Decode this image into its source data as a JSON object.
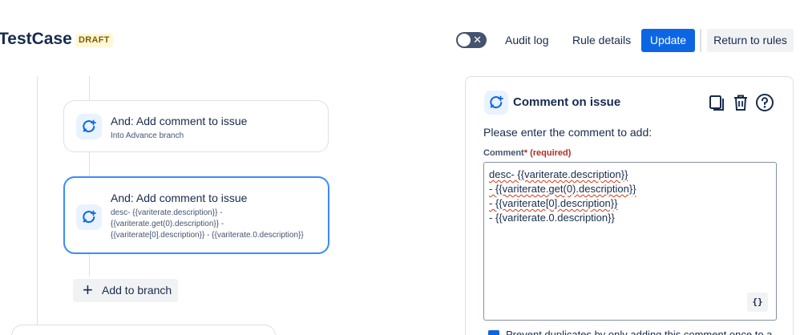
{
  "header": {
    "title": "TestCase",
    "badge": "DRAFT",
    "toggle_symbol": "✕",
    "audit_log": "Audit log",
    "rule_details": "Rule details",
    "update": "Update",
    "return_to_rules": "Return to rules"
  },
  "flow": {
    "items": [
      {
        "title": "And: Add comment to issue",
        "subtitle": "Into Advance branch",
        "icon": "comment-add-icon"
      },
      {
        "title": "And: Add comment to issue",
        "subtitle": "desc- {{variterate.description}} - {{variterate.get(0).description}} - {{variterate[0].description}} - {{variterate.0.description}}",
        "icon": "comment-add-icon"
      }
    ],
    "add_to_branch": "Add to branch"
  },
  "panel": {
    "title": "Comment on issue",
    "prompt": "Please enter the comment to add:",
    "field_label": "Comment",
    "required_marker": "*",
    "required_text": "(required)",
    "comment_lines": [
      "desc- {{variterate.description}}",
      "- {{variterate.get(0).description}}",
      "- {{variterate[0].description}}",
      "- {{variterate.0.description}}"
    ],
    "smart_values_button": "{}",
    "checkbox_label": "Prevent duplicates by only adding this comment once to a"
  },
  "colors": {
    "primary": "#0c66e4",
    "selected_border": "#388bff",
    "badge_bg": "#fff7d6",
    "text": "#172b4d"
  }
}
